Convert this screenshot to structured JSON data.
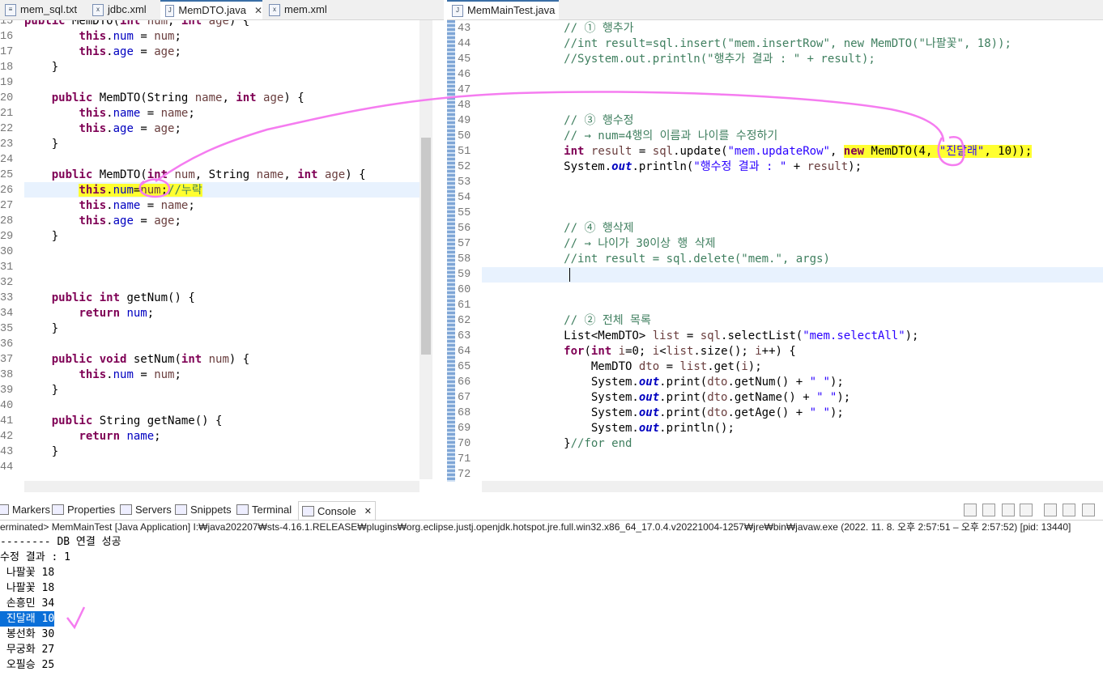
{
  "left_tabs": [
    {
      "label": "mem_sql.txt"
    },
    {
      "label": "jdbc.xml"
    },
    {
      "label": "MemDTO.java",
      "close": "✕"
    },
    {
      "label": "mem.xml"
    }
  ],
  "right_tabs": [
    {
      "label": "MemMainTest.java"
    }
  ],
  "left_lines": {
    "n15": "15",
    "l15": "    public MemDTO(int num, int age) {",
    "n16": "16",
    "n17": "17",
    "n18": "18",
    "n19": "19",
    "n20": "20",
    "n21": "21",
    "n22": "22",
    "n23": "23",
    "n24": "24",
    "n25": "25",
    "n26": "26",
    "n27": "27",
    "n28": "28",
    "n29": "29",
    "n30": "30",
    "n31": "31",
    "n32": "32",
    "n33": "33",
    "n34": "34",
    "n35": "35",
    "n36": "36",
    "n37": "37",
    "n38": "38",
    "n39": "39",
    "n40": "40",
    "n41": "41",
    "n42": "42",
    "n43": "43",
    "n44": "44",
    "comment_missing": "//누락"
  },
  "right_lines": {
    "n43": "43",
    "n44": "44",
    "n45": "45",
    "n46": "46",
    "n47": "47",
    "n48": "48",
    "n49": "49",
    "n50": "50",
    "n51": "51",
    "n52": "52",
    "n53": "53",
    "n54": "54",
    "n55": "55",
    "n56": "56",
    "n57": "57",
    "n58": "58",
    "n59": "59",
    "n60": "60",
    "n61": "61",
    "n62": "62",
    "n63": "63",
    "n64": "64",
    "n65": "65",
    "n66": "66",
    "n67": "67",
    "n68": "68",
    "n69": "69",
    "n70": "70",
    "n71": "71",
    "n72": "72",
    "c43": "// ① 행추가",
    "c44": "//int result=sql.insert(\"mem.insertRow\", new MemDTO(\"나팔꽃\", 18));",
    "c45": "//System.out.println(\"행추가 결과 : \" + result);",
    "c49": "// ③ 행수정",
    "c50": "// → num=4행의 이름과 나이를 수정하기",
    "c56": "// ④ 행삭제",
    "c57": "// → 나이가 30이상 행 삭제",
    "c58": "//int result = sql.delete(\"mem.\", args)",
    "c62": "// ② 전체 목록",
    "s51a": "\"mem.updateRow\"",
    "s51b": "\"진달래\"",
    "s52": "\"행수정 결과 : \"",
    "s63": "\"mem.selectAll\"",
    "s66": "\" \"",
    "c70": "//for end"
  },
  "views": {
    "markers": "Markers",
    "properties": "Properties",
    "servers": "Servers",
    "snippets": "Snippets",
    "terminal": "Terminal",
    "console": "Console"
  },
  "console": {
    "header": "erminated> MemMainTest [Java Application] I:₩java202207₩sts-4.16.1.RELEASE₩plugins₩org.eclipse.justj.openjdk.hotspot.jre.full.win32.x86_64_17.0.4.v20221004-1257₩jre₩bin₩javaw.exe  (2022. 11. 8. 오후 2:57:51 – 오후 2:57:52) [pid: 13440]",
    "lines": [
      "-------- DB 연결 성공",
      "수정 결과 : 1",
      " 나팔꽃 18",
      " 나팔꽃 18",
      " 손흥민 34",
      " 진달래 10",
      " 봉선화 30",
      " 무궁화 27",
      " 오필승 25"
    ]
  },
  "colors": {
    "keyword": "#7f0055",
    "field": "#0000c0",
    "string": "#2a00ff",
    "comment": "#3f7f5f",
    "highlight": "#ffff30",
    "annotation": "#f57cf0",
    "selection": "#0a6fd8"
  }
}
